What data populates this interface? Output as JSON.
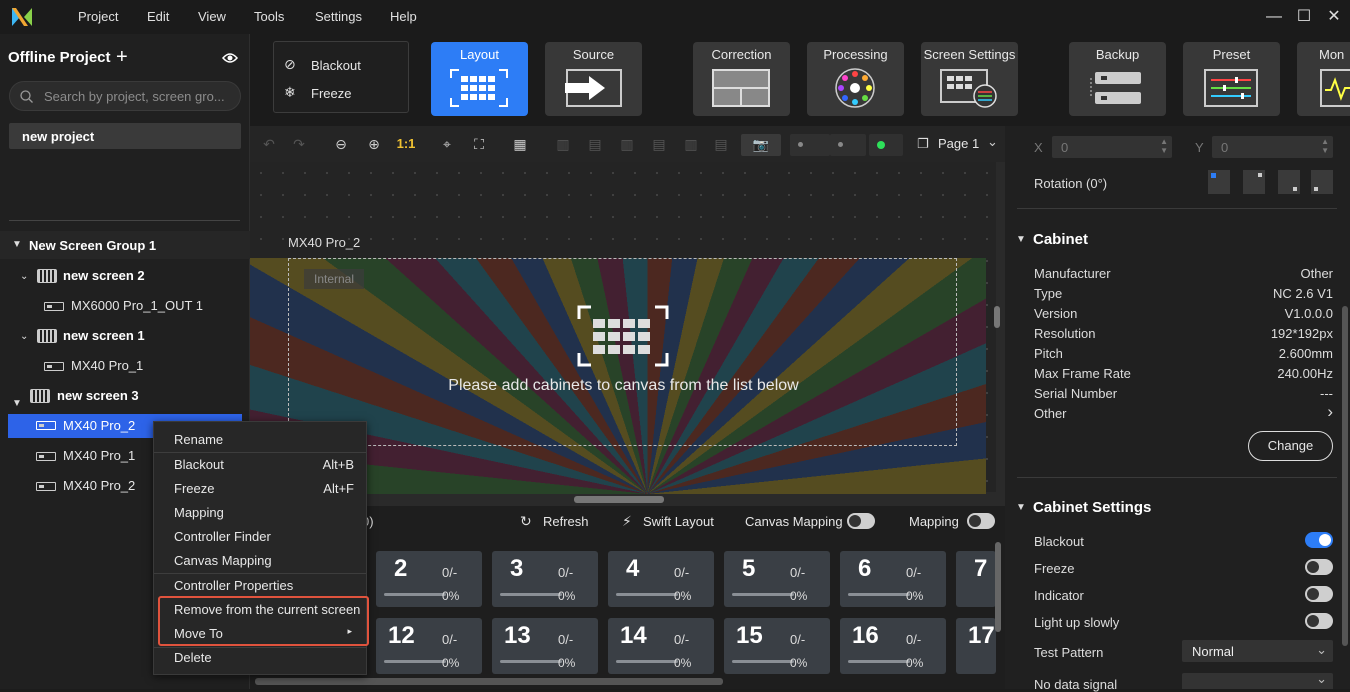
{
  "menu": [
    "Project",
    "Edit",
    "View",
    "Tools",
    "Settings",
    "Help"
  ],
  "project": {
    "title": "Offline Project",
    "search_placeholder": "Search by project, screen gro...",
    "item": "new project"
  },
  "tree": {
    "group": "New Screen Group 1",
    "screens": [
      {
        "name": "new screen 2",
        "controllers": [
          "MX6000 Pro_1_OUT 1"
        ]
      },
      {
        "name": "new screen 1",
        "controllers": [
          "MX40 Pro_1"
        ]
      },
      {
        "name": "new screen 3",
        "controllers": [
          "MX40 Pro_2"
        ]
      }
    ],
    "extra": [
      "MX40 Pro_1",
      "MX40 Pro_2"
    ]
  },
  "quick": {
    "blackout": "Blackout",
    "freeze": "Freeze"
  },
  "tabs": [
    "Layout",
    "Source",
    "Correction",
    "Processing",
    "Screen Settings",
    "Backup",
    "Preset",
    "Mon"
  ],
  "canvas": {
    "zoom_label": "1:1",
    "page": "Page 1",
    "screen_label": "MX40 Pro_2",
    "internal": "Internal",
    "hint": "Please add cabinets to canvas from the list below"
  },
  "bottom": {
    "count_suffix": "0)",
    "refresh": "Refresh",
    "swift": "Swift Layout",
    "canvas_mapping": "Canvas Mapping",
    "mapping": "Mapping",
    "tiles": [
      {
        "n": "2",
        "f": "0/-",
        "p": "0%"
      },
      {
        "n": "3",
        "f": "0/-",
        "p": "0%"
      },
      {
        "n": "4",
        "f": "0/-",
        "p": "0%"
      },
      {
        "n": "5",
        "f": "0/-",
        "p": "0%"
      },
      {
        "n": "6",
        "f": "0/-",
        "p": "0%"
      },
      {
        "n": "7",
        "f": "",
        "p": ""
      },
      {
        "n": "12",
        "f": "0/-",
        "p": "0%"
      },
      {
        "n": "13",
        "f": "0/-",
        "p": "0%"
      },
      {
        "n": "14",
        "f": "0/-",
        "p": "0%"
      },
      {
        "n": "15",
        "f": "0/-",
        "p": "0%"
      },
      {
        "n": "16",
        "f": "0/-",
        "p": "0%"
      },
      {
        "n": "17",
        "f": "",
        "p": ""
      }
    ]
  },
  "right": {
    "x_label": "X",
    "x_val": "0",
    "y_label": "Y",
    "y_val": "0",
    "rotation": "Rotation (0°)",
    "cabinet_title": "Cabinet",
    "props": [
      {
        "k": "Manufacturer",
        "v": "Other"
      },
      {
        "k": "Type",
        "v": "NC 2.6 V1"
      },
      {
        "k": "Version",
        "v": "V1.0.0.0"
      },
      {
        "k": "Resolution",
        "v": "192*192px"
      },
      {
        "k": "Pitch",
        "v": "2.600mm"
      },
      {
        "k": "Max Frame Rate",
        "v": "240.00Hz"
      },
      {
        "k": "Serial Number",
        "v": "---"
      },
      {
        "k": "Other",
        "v": "›"
      }
    ],
    "change": "Change",
    "settings_title": "Cabinet Settings",
    "settings": [
      {
        "k": "Blackout",
        "on": true
      },
      {
        "k": "Freeze",
        "on": false
      },
      {
        "k": "Indicator",
        "on": false
      },
      {
        "k": "Light up slowly",
        "on": false
      }
    ],
    "test_pattern": "Test Pattern",
    "test_value": "Normal",
    "no_signal": "No data signal"
  },
  "context_menu": {
    "items": [
      {
        "label": "Rename",
        "sc": ""
      },
      {
        "label": "Blackout",
        "sc": "Alt+B"
      },
      {
        "label": "Freeze",
        "sc": "Alt+F"
      },
      {
        "label": "Mapping",
        "sc": ""
      },
      {
        "label": "Controller Finder",
        "sc": ""
      },
      {
        "label": "Canvas Mapping",
        "sc": ""
      },
      {
        "label": "Controller Properties",
        "sc": ""
      },
      {
        "label": "Remove from the current screen",
        "sc": ""
      },
      {
        "label": "Move To",
        "sc": "▸"
      },
      {
        "label": "Delete",
        "sc": ""
      }
    ]
  },
  "colors": {
    "accent": "#2d7df6",
    "highlight_box": "#e0533d"
  }
}
